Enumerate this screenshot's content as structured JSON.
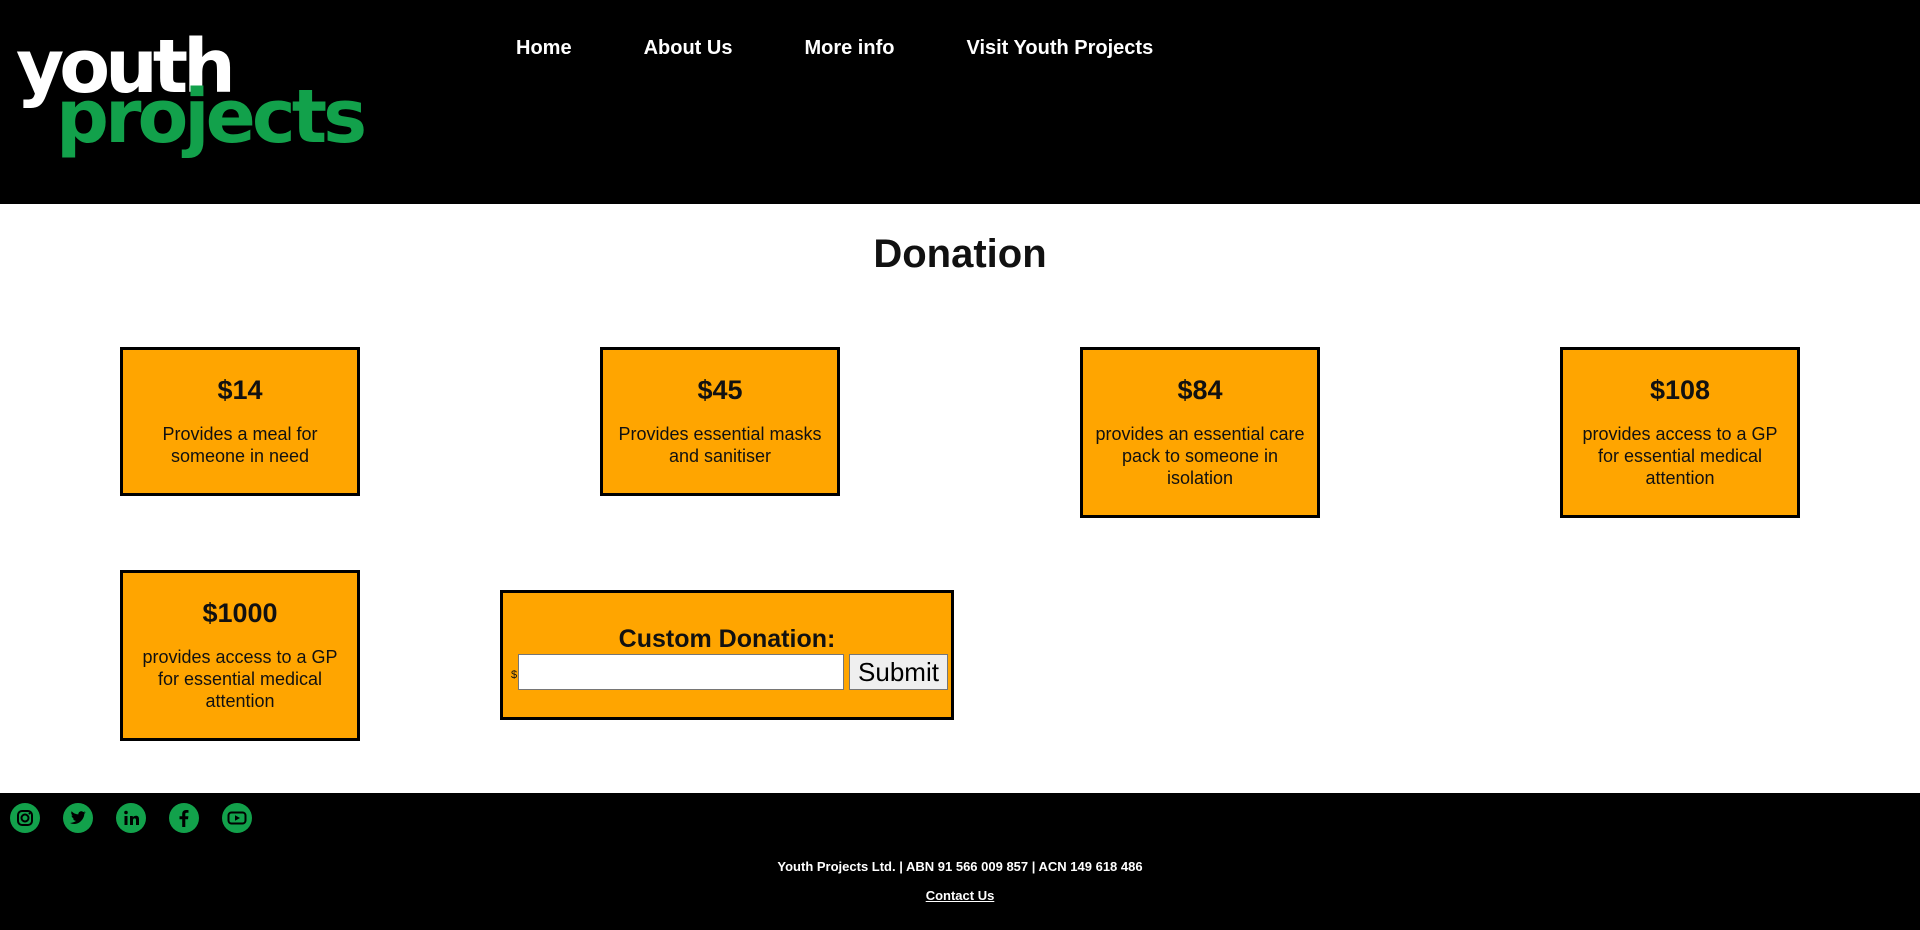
{
  "header": {
    "logo": {
      "line1": "youth",
      "line2": "projects"
    },
    "nav": [
      {
        "label": "Home"
      },
      {
        "label": "About Us"
      },
      {
        "label": "More info"
      },
      {
        "label": "Visit Youth Projects"
      }
    ]
  },
  "main": {
    "title": "Donation",
    "cards": [
      {
        "amount": "$14",
        "description": "Provides a meal for someone in need"
      },
      {
        "amount": "$45",
        "description": "Provides essential masks and sanitiser"
      },
      {
        "amount": "$84",
        "description": "provides an essential care pack to someone in isolation"
      },
      {
        "amount": "$108",
        "description": "provides access to a GP for essential medical attention"
      },
      {
        "amount": "$1000",
        "description": "provides access to a GP for essential medical attention"
      }
    ],
    "custom": {
      "title": "Custom Donation:",
      "currency": "$",
      "value": "",
      "submit_label": "Submit"
    }
  },
  "footer": {
    "social": [
      "instagram-icon",
      "twitter-icon",
      "linkedin-icon",
      "facebook-icon",
      "youtube-icon"
    ],
    "legal": "Youth Projects Ltd. | ABN 91 566 009 857 | ACN 149 618 486",
    "contact": "Contact Us"
  },
  "colors": {
    "header_bg": "#000000",
    "brand_green": "#12a14b",
    "card_bg": "#ffa500",
    "footer_bg": "#000000"
  }
}
